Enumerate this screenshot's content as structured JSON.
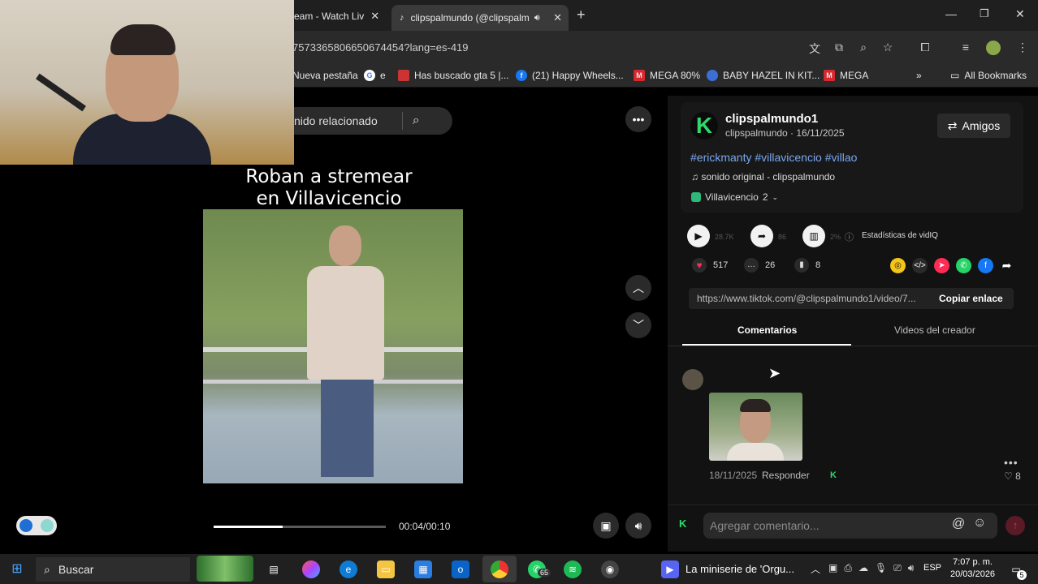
{
  "browser": {
    "tabs": [
      {
        "label": "eam - Watch Liv",
        "close": "✕"
      },
      {
        "label": "clipspalmundo (@clipspalm",
        "close": "✕"
      }
    ],
    "new_tab": "+",
    "url": "757336580665067445​4?lang=es-419",
    "bookmarks": [
      {
        "label": "Nueva pestaña"
      },
      {
        "label": "e"
      },
      {
        "label": "Has buscado gta 5 |..."
      },
      {
        "label": "(21) Happy Wheels..."
      },
      {
        "label": "MEGA 80%"
      },
      {
        "label": "BABY HAZEL IN KIT..."
      },
      {
        "label": "MEGA"
      }
    ],
    "all_bookmarks": "All Bookmarks"
  },
  "player": {
    "search_placeholder": "nido relacionado",
    "title_line1": "Roban a stremear",
    "title_line2": "en Villavicencio",
    "time": "00:04/00:10",
    "progress": 0.4
  },
  "post": {
    "username": "clipspalmundo1",
    "subline": "clipspalmundo · 16/11/2025",
    "friends_button": "Amigos",
    "hashtags": "#erickmanty #villavicencio #villao",
    "sound": "sonido original - clipspalmundo",
    "place": "Villavicencio",
    "place_count": "2",
    "stat_plays": "28.7K",
    "stat_shares": "86",
    "stat_pct": "2%",
    "vidiq_label": "Estadísticas de vidIQ",
    "likes": "517",
    "comments": "26",
    "saves": "8",
    "link": "https://www.tiktok.com/@clipspalmundo1/video/7...",
    "copy_label": "Copiar enlace",
    "tab_comments": "Comentarios",
    "tab_videos": "Videos del creador"
  },
  "comment": {
    "date": "18/11/2025",
    "reply": "Responder",
    "likes": "8",
    "input_placeholder": "Agregar comentario..."
  },
  "taskbar": {
    "search": "Buscar",
    "whatsapp_badge": "65",
    "media_title": "La miniserie de 'Orgu...",
    "lang": "ESP",
    "time": "7:07 p. m.",
    "date": "20/03/2026",
    "notif_count": "5"
  },
  "colors": {
    "accent_link": "#7aa7f0",
    "like_red": "#fe2c55",
    "brand_green": "#2fd86b"
  }
}
